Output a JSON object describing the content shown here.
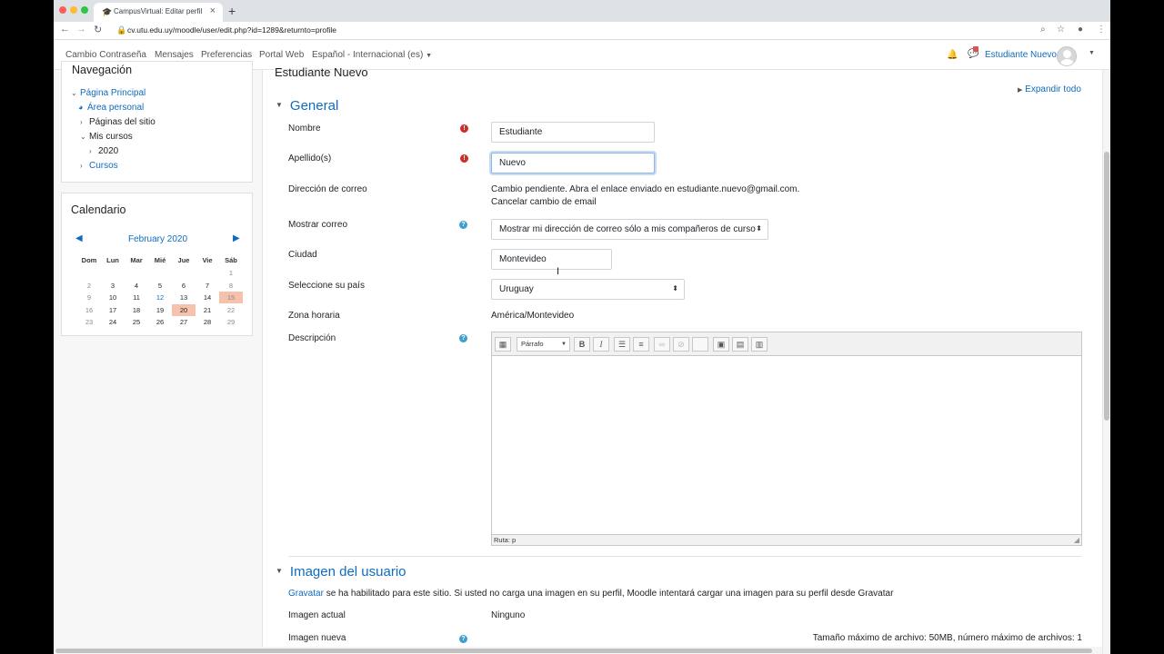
{
  "browser": {
    "tab_title": "CampusVirtual: Editar perfil",
    "url": "cv.utu.edu.uy/moodle/user/edit.php?id=1289&returnto=profile"
  },
  "topnav": {
    "links": [
      "Cambio Contraseña",
      "Mensajes",
      "Preferencias",
      "Portal Web",
      "Español - Internacional (es)"
    ],
    "username": "Estudiante Nuevo"
  },
  "sidebar": {
    "nav_title": "Navegación",
    "items": [
      "Página Principal",
      "Área personal",
      "Páginas del sitio",
      "Mis cursos",
      "2020",
      "Cursos"
    ],
    "calendar": {
      "title": "Calendario",
      "month": "February 2020",
      "days": [
        "Dom",
        "Lun",
        "Mar",
        "Mié",
        "Jue",
        "Vie",
        "Sáb"
      ],
      "weeks": [
        [
          "",
          "",
          "",
          "",
          "",
          "",
          "1"
        ],
        [
          "2",
          "3",
          "4",
          "5",
          "6",
          "7",
          "8"
        ],
        [
          "9",
          "10",
          "11",
          "12",
          "13",
          "14",
          "15"
        ],
        [
          "16",
          "17",
          "18",
          "19",
          "20",
          "21",
          "22"
        ],
        [
          "23",
          "24",
          "25",
          "26",
          "27",
          "28",
          "29"
        ]
      ],
      "event_days": [
        "15",
        "20"
      ],
      "link_days": [
        "12"
      ]
    }
  },
  "main": {
    "page_title": "Estudiante Nuevo",
    "expand_all": "Expandir todo",
    "general": {
      "title": "General",
      "nombre_label": "Nombre",
      "nombre_value": "Estudiante",
      "apellido_label": "Apellido(s)",
      "apellido_value": "Nuevo",
      "correo_label": "Dirección de correo",
      "correo_text": "Cambio pendiente. Abra el enlace enviado en estudiante.nuevo@gmail.com.",
      "correo_cancel": "Cancelar cambio de email",
      "mostrar_label": "Mostrar correo",
      "mostrar_value": "Mostrar mi dirección de correo sólo a mis compañeros de curso",
      "ciudad_label": "Ciudad",
      "ciudad_value": "Montevideo",
      "pais_label": "Seleccione su país",
      "pais_value": "Uruguay",
      "zona_label": "Zona horaria",
      "zona_value": "América/Montevideo",
      "desc_label": "Descripción",
      "editor_format": "Párrafo",
      "editor_path": "Ruta: p"
    },
    "imagen": {
      "title": "Imagen del usuario",
      "gravatar_link": "Gravatar",
      "gravatar_text": "se ha habilitado para este sitio. Si usted no carga una imagen en su perfil, Moodle intentará cargar una imagen para su perfil desde Gravatar",
      "actual_label": "Imagen actual",
      "actual_value": "Ninguno",
      "nueva_label": "Imagen nueva",
      "max_text": "Tamaño máximo de archivo: 50MB, número máximo de archivos: 1"
    }
  }
}
